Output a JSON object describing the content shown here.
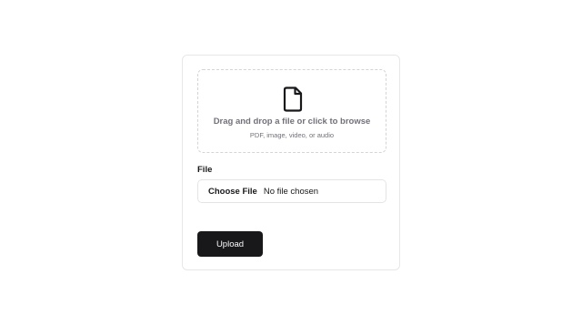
{
  "dropzone": {
    "icon": "file-icon",
    "title": "Drag and drop a file or click to browse",
    "subtitle": "PDF, image, video, or audio"
  },
  "file_field": {
    "label": "File",
    "button_label": "Choose File",
    "status": "No file chosen"
  },
  "actions": {
    "upload_label": "Upload"
  },
  "colors": {
    "primary": "#18181b",
    "muted_text": "#71717a",
    "border": "#e5e7eb"
  }
}
